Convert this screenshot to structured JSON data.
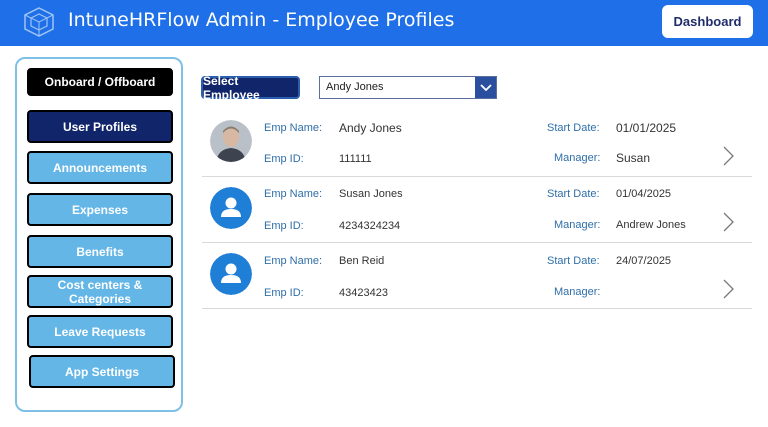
{
  "header": {
    "title": "IntuneHRFlow Admin - Employee Profiles",
    "dashboard_label": "Dashboard",
    "bar_color": "#1e6fe8",
    "logo_icon": "app-logo-icon"
  },
  "sidebar": {
    "items": [
      {
        "label": "Onboard / Offboard"
      },
      {
        "label": "User Profiles"
      },
      {
        "label": "Announcements"
      },
      {
        "label": "Expenses"
      },
      {
        "label": "Benefits"
      },
      {
        "label": "Cost centers & Categories"
      },
      {
        "label": "Leave Requests"
      },
      {
        "label": "App Settings"
      }
    ],
    "active_item": "User Profiles"
  },
  "selector": {
    "label": "Select Employee",
    "selected": "Andy Jones"
  },
  "fields": {
    "name_label": "Emp Name:",
    "id_label": "Emp ID:",
    "start_label": "Start Date:",
    "manager_label": "Manager:"
  },
  "employees": [
    {
      "name": "Andy Jones",
      "id": "111111",
      "start": "01/01/2025",
      "manager": "Susan",
      "avatar": "photo"
    },
    {
      "name": "Susan Jones",
      "id": "4234324234",
      "start": "01/04/2025",
      "manager": "Andrew Jones",
      "avatar": "person-icon"
    },
    {
      "name": "Ben Reid",
      "id": "43423423",
      "start": "24/07/2025",
      "manager": "",
      "avatar": "person-icon"
    }
  ]
}
